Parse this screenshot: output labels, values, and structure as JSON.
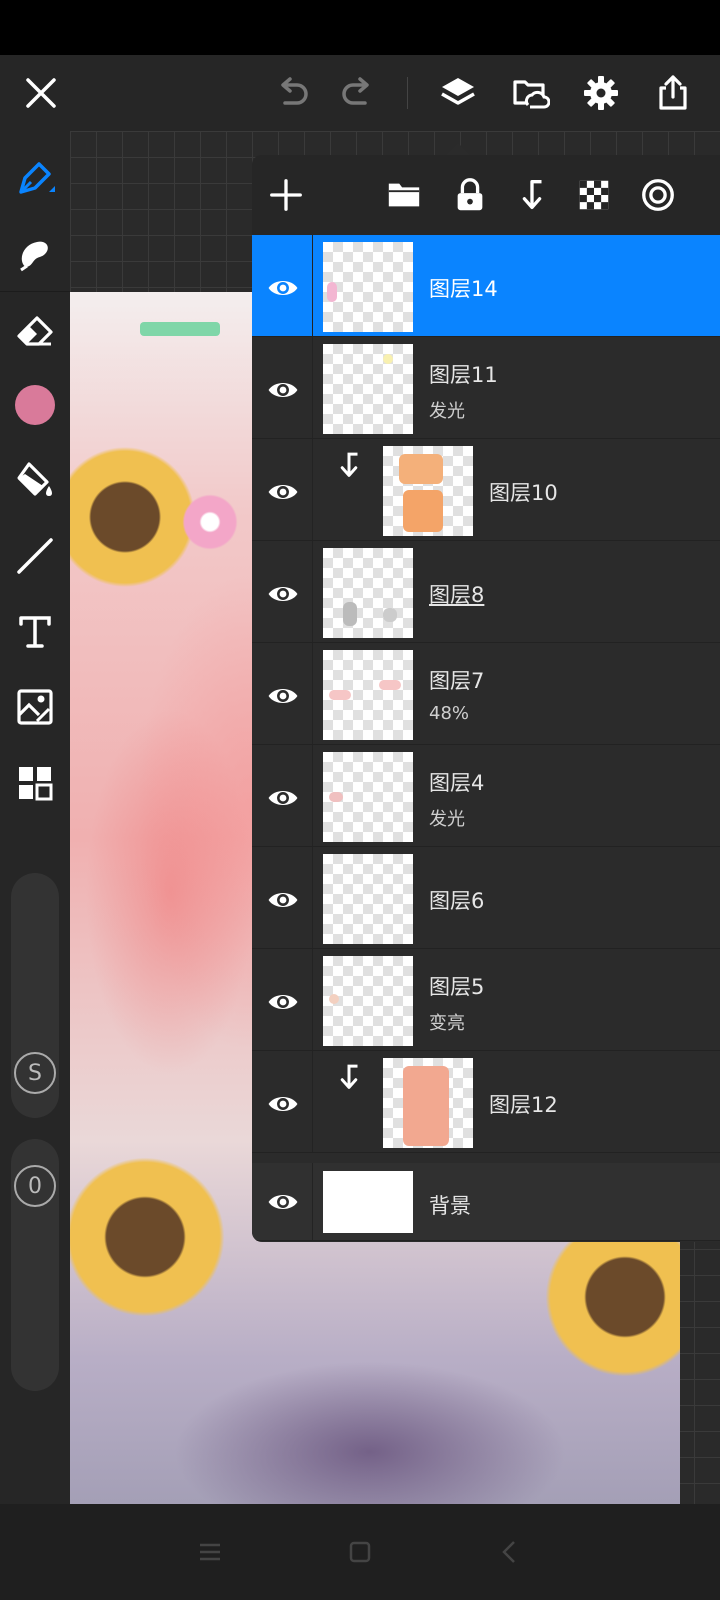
{
  "toolbar": {
    "icons": [
      "close-icon",
      "undo-icon",
      "redo-icon",
      "layers-icon",
      "cloud-folder-icon",
      "gear-icon",
      "share-icon"
    ]
  },
  "tools": {
    "icons": [
      "pen-icon",
      "smudge-icon",
      "eraser-icon",
      "color-swatch",
      "fill-bucket-icon",
      "line-icon",
      "text-icon",
      "image-icon",
      "grid-icon"
    ],
    "color": "#d97a9a",
    "size_badge": "S",
    "opacity_badge": "0"
  },
  "layers_toolbar": {
    "icons": [
      "add-icon",
      "folder-icon",
      "lock-icon",
      "clip-arrow-icon",
      "transparency-icon",
      "target-icon"
    ]
  },
  "layers": [
    {
      "name": "图层14",
      "sub": "",
      "selected": true,
      "clipped": false
    },
    {
      "name": "图层11",
      "sub": "发光",
      "selected": false,
      "clipped": false
    },
    {
      "name": "图层10",
      "sub": "",
      "selected": false,
      "clipped": true
    },
    {
      "name": "图层8",
      "sub": "",
      "selected": false,
      "clipped": false
    },
    {
      "name": "图层7",
      "sub": "48%",
      "selected": false,
      "clipped": false
    },
    {
      "name": "图层4",
      "sub": "发光",
      "selected": false,
      "clipped": false
    },
    {
      "name": "图层6",
      "sub": "",
      "selected": false,
      "clipped": false
    },
    {
      "name": "图层5",
      "sub": "变亮",
      "selected": false,
      "clipped": false
    },
    {
      "name": "图层12",
      "sub": "",
      "selected": false,
      "clipped": true
    }
  ],
  "background_layer": {
    "name": "背景"
  },
  "colors": {
    "accent": "#0a84ff",
    "panel": "#2b2b2b"
  }
}
